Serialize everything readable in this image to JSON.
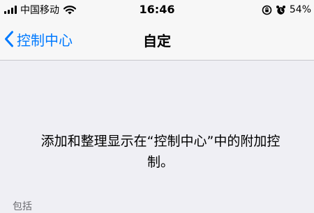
{
  "status_bar": {
    "carrier": "中国移动",
    "time": "16:46",
    "battery": "54%"
  },
  "nav": {
    "back_label": "控制中心",
    "title": "自定"
  },
  "description": "添加和整理显示在“控制中心”中的附加控制。",
  "section": {
    "header": "包括"
  },
  "colors": {
    "accent": "#007aff",
    "background": "#efeff4",
    "bar": "#f7f7f7"
  }
}
